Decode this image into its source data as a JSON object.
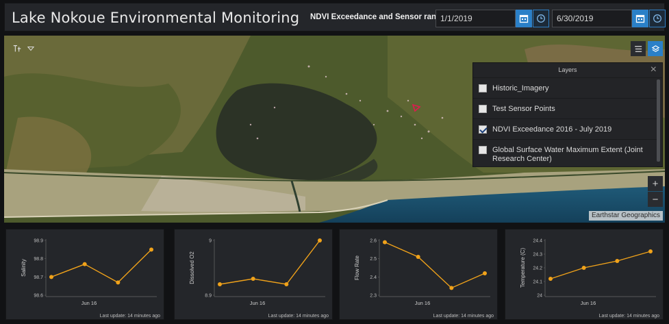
{
  "app": {
    "title": "Lake Nokoue Environmental Monitoring"
  },
  "date_range": {
    "label": "NDVI Exceedance and Sensor range",
    "start": "1/1/2019",
    "end": "6/30/2019"
  },
  "icons": {
    "calendar": "calendar-icon",
    "clock": "clock-icon",
    "basemap_tool": "basemap-tool-icon",
    "legend": "legend-list-icon",
    "layers": "layers-icon"
  },
  "layers_panel": {
    "title": "Layers",
    "items": [
      {
        "label": "Historic_Imagery",
        "checked": false
      },
      {
        "label": "Test Sensor Points",
        "checked": false
      },
      {
        "label": "NDVI Exceedance 2016 - July 2019",
        "checked": true
      },
      {
        "label": "Global Surface Water Maximum Extent (Joint Research Center)",
        "checked": false
      }
    ]
  },
  "map": {
    "attribution": "Earthstar Geographics",
    "zoom_in": "+",
    "zoom_out": "−"
  },
  "colors": {
    "accent": "#2a80c8",
    "series": "#f0a21a",
    "panel": "#24262a"
  },
  "chart_data": [
    {
      "type": "line",
      "ylabel": "Salinity",
      "yticks": [
        "98.9",
        "98.8",
        "98.7",
        "98.6"
      ],
      "ylim": [
        98.6,
        98.9
      ],
      "xtick": "Jun 16",
      "values": [
        98.7,
        98.77,
        98.67,
        98.85
      ],
      "footer": "Last update: 14 minutes ago"
    },
    {
      "type": "line",
      "ylabel": "Dissolved O2",
      "yticks": [
        "9",
        "8.9"
      ],
      "ylim": [
        8.9,
        9.0
      ],
      "xtick": "Jun 16",
      "values": [
        8.92,
        8.93,
        8.92,
        9.0
      ],
      "footer": "Last update: 14 minutes ago"
    },
    {
      "type": "line",
      "ylabel": "Flow Rate",
      "yticks": [
        "2.6",
        "2.5",
        "2.4",
        "2.3"
      ],
      "ylim": [
        2.3,
        2.6
      ],
      "xtick": "Jun 16",
      "values": [
        2.59,
        2.51,
        2.34,
        2.42
      ],
      "footer": "Last update: 14 minutes ago"
    },
    {
      "type": "line",
      "ylabel": "Temperature (C)",
      "yticks": [
        "24.4",
        "24.3",
        "24.2",
        "24.1",
        "24"
      ],
      "ylim": [
        24.0,
        24.4
      ],
      "xtick": "Jun 16",
      "values": [
        24.12,
        24.2,
        24.25,
        24.32
      ],
      "footer": "Last update: 14 minutes ago"
    }
  ]
}
